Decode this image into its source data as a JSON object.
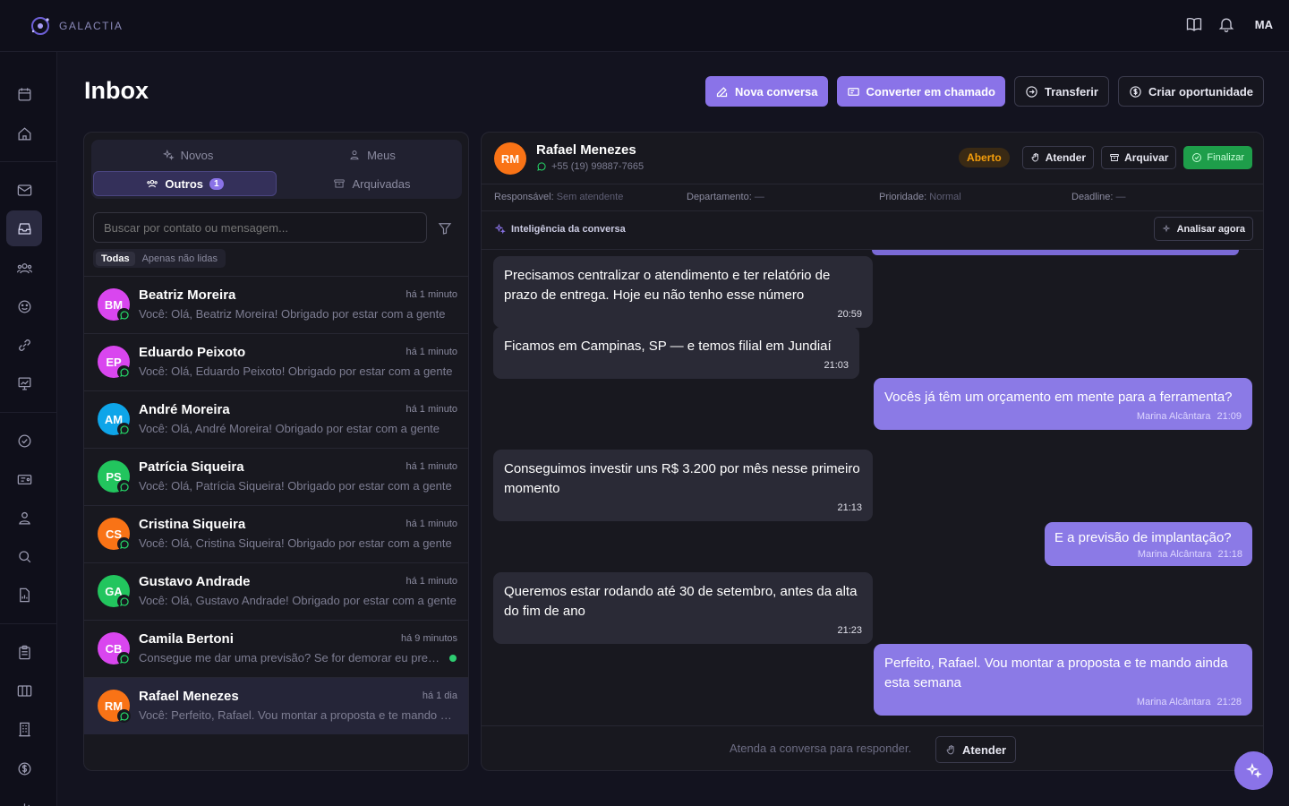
{
  "brand": {
    "name": "GALACTIA"
  },
  "topbar": {
    "user_initials": "MA"
  },
  "page": {
    "title": "Inbox"
  },
  "actions": {
    "new_conversation": "Nova conversa",
    "convert_ticket": "Converter em chamado",
    "transfer": "Transferir",
    "create_opportunity": "Criar oportunidade"
  },
  "tabs": {
    "novos": "Novos",
    "meus": "Meus",
    "outros": "Outros",
    "outros_count": "1",
    "arquivadas": "Arquivadas"
  },
  "search": {
    "placeholder": "Buscar por contato ou mensagem..."
  },
  "filters": {
    "all": "Todas",
    "unread": "Apenas não lidas"
  },
  "conversations": [
    {
      "initials": "BM",
      "name": "Beatriz Moreira",
      "time": "há 1 minuto",
      "preview": "Você: Olá, Beatriz Moreira! Obrigado por estar com a gente",
      "color": "#d946ef"
    },
    {
      "initials": "EP",
      "name": "Eduardo Peixoto",
      "time": "há 1 minuto",
      "preview": "Você: Olá, Eduardo Peixoto! Obrigado por estar com a gente",
      "color": "#d946ef"
    },
    {
      "initials": "AM",
      "name": "André Moreira",
      "time": "há 1 minuto",
      "preview": "Você: Olá, André Moreira! Obrigado por estar com a gente",
      "color": "#0ea5e9"
    },
    {
      "initials": "PS",
      "name": "Patrícia Siqueira",
      "time": "há 1 minuto",
      "preview": "Você: Olá, Patrícia Siqueira! Obrigado por estar com a gente",
      "color": "#22c55e"
    },
    {
      "initials": "CS",
      "name": "Cristina Siqueira",
      "time": "há 1 minuto",
      "preview": "Você: Olá, Cristina Siqueira! Obrigado por estar com a gente",
      "color": "#f97316"
    },
    {
      "initials": "GA",
      "name": "Gustavo Andrade",
      "time": "há 1 minuto",
      "preview": "Você: Olá, Gustavo Andrade! Obrigado por estar com a gente",
      "color": "#22c55e"
    },
    {
      "initials": "CB",
      "name": "Camila Bertoni",
      "time": "há 9 minutos",
      "preview": "Consegue me dar uma previsão? Se for demorar eu preciso saber",
      "color": "#d946ef",
      "unread": true
    },
    {
      "initials": "RM",
      "name": "Rafael Menezes",
      "time": "há 1 dia",
      "preview": "Você: Perfeito, Rafael. Vou montar a proposta e te mando ainda esta semana",
      "color": "#f97316",
      "selected": true
    }
  ],
  "chat": {
    "contact_initials": "RM",
    "contact_name": "Rafael Menezes",
    "contact_phone": "+55 (19) 99887-7665",
    "status": "Aberto",
    "btn_attend": "Atender",
    "btn_archive": "Arquivar",
    "btn_finish": "Finalizar",
    "meta": {
      "responsavel_label": "Responsável:",
      "responsavel_value": "Sem atendente",
      "departamento_label": "Departamento:",
      "departamento_value": "—",
      "prioridade_label": "Prioridade:",
      "prioridade_value": "Normal",
      "deadline_label": "Deadline:",
      "deadline_value": "—"
    },
    "intel_title": "Inteligência da conversa",
    "analyze_now": "Analisar agora",
    "messages": [
      {
        "dir": "in",
        "text": "Precisamos centralizar o atendimento e ter relatório de prazo de entrega. Hoje eu não tenho esse número",
        "time": "20:59"
      },
      {
        "dir": "in",
        "text": "Ficamos em Campinas, SP — e temos filial em Jundiaí",
        "time": "21:03"
      },
      {
        "dir": "out",
        "text": "Vocês já têm um orçamento em mente para a ferramenta?",
        "agent": "Marina Alcântara",
        "time": "21:09"
      },
      {
        "dir": "in",
        "text": "Conseguimos investir uns R$ 3.200 por mês nesse primeiro momento",
        "time": "21:13"
      },
      {
        "dir": "out",
        "text": "E a previsão de implantação?",
        "agent": "Marina Alcântara",
        "time": "21:18"
      },
      {
        "dir": "in",
        "text": "Queremos estar rodando até 30 de setembro, antes da alta do fim de ano",
        "time": "21:23"
      },
      {
        "dir": "out",
        "text": "Perfeito, Rafael. Vou montar a proposta e te mando ainda esta semana",
        "agent": "Marina Alcântara",
        "time": "21:28"
      }
    ],
    "footer_text": "Atenda a conversa para responder.",
    "footer_btn": "Atender"
  }
}
